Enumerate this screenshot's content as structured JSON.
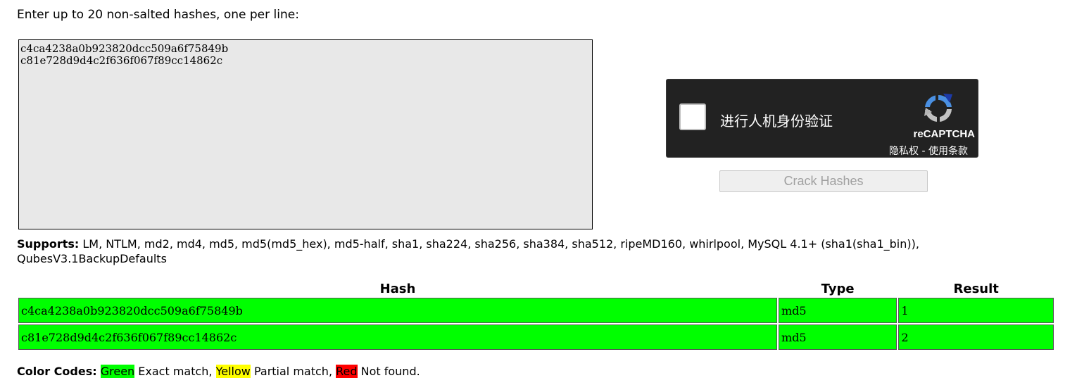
{
  "intro": "Enter up to 20 non-salted hashes, one per line:",
  "hash_input": {
    "value": "c4ca4238a0b923820dcc509a6f75849b\nc81e728d9d4c2f636f067f89cc14862c"
  },
  "recaptcha": {
    "label": "进行人机身份验证",
    "brand": "reCAPTCHA",
    "terms": "隐私权 - 使用条款",
    "logo_icon": "recaptcha-logo-icon",
    "checked": false
  },
  "crack_button": "Crack Hashes",
  "supports": {
    "label": "Supports:",
    "text": "LM, NTLM, md2, md4, md5, md5(md5_hex), md5-half, sha1, sha224, sha256, sha384, sha512, ripeMD160, whirlpool, MySQL 4.1+ (sha1(sha1_bin)), QubesV3.1BackupDefaults"
  },
  "table": {
    "headers": [
      "Hash",
      "Type",
      "Result"
    ],
    "rows": [
      {
        "hash": "c4ca4238a0b923820dcc509a6f75849b",
        "type": "md5",
        "result": "1",
        "status_color": "#00ff00"
      },
      {
        "hash": "c81e728d9d4c2f636f067f89cc14862c",
        "type": "md5",
        "result": "2",
        "status_color": "#00ff00"
      }
    ]
  },
  "legend": {
    "label": "Color Codes:",
    "green": "Green",
    "green_desc": "Exact match,",
    "yellow": "Yellow",
    "yellow_desc": "Partial match,",
    "red": "Red",
    "red_desc": "Not found."
  },
  "colors": {
    "exact_match": "#00ff00",
    "partial_match": "#ffff00",
    "not_found": "#ff0000",
    "recaptcha_bg": "#222222"
  }
}
